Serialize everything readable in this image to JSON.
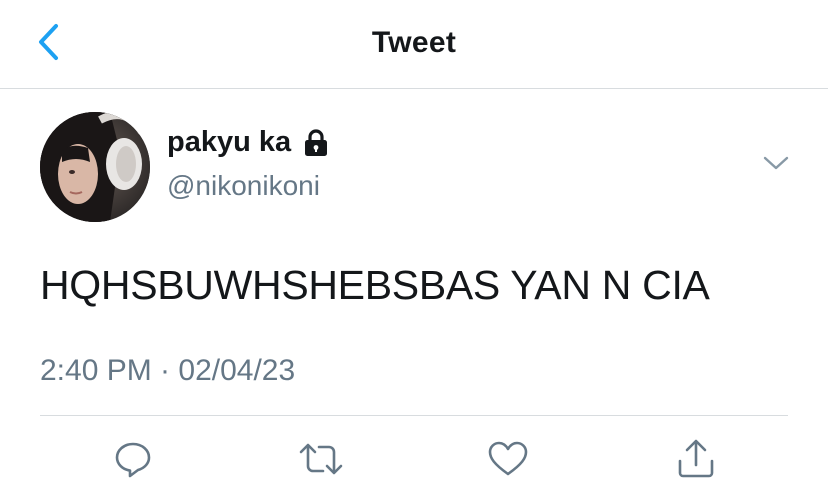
{
  "header": {
    "title": "Tweet",
    "back_icon": "chevron-left-icon"
  },
  "colors": {
    "accent": "#1da1f2",
    "text": "#14171a",
    "secondary": "#657786",
    "divider": "#d8dcdf"
  },
  "tweet": {
    "author": {
      "display_name": "pakyu ka",
      "handle": "@nikonikoni",
      "protected_icon": "lock-icon"
    },
    "text": "HQHSBUWHSHEBSBAS YAN N CIA",
    "timestamp": "2:40 PM · 02/04/23"
  },
  "actions": [
    {
      "icon": "reply-icon"
    },
    {
      "icon": "retweet-icon"
    },
    {
      "icon": "heart-icon"
    },
    {
      "icon": "share-icon"
    }
  ]
}
